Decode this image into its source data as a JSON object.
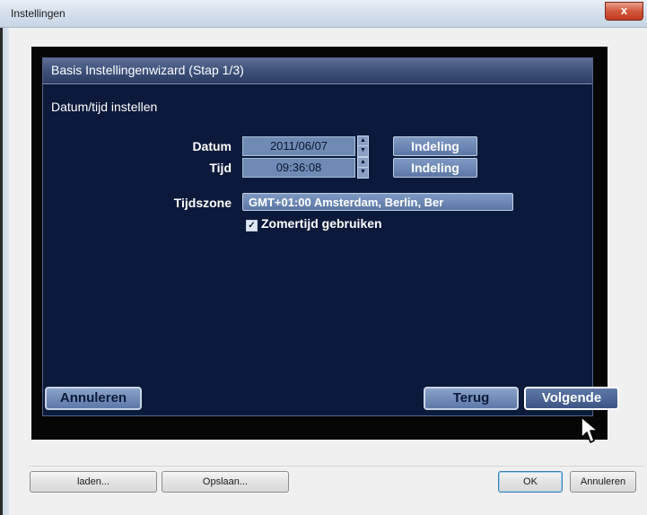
{
  "window": {
    "title": "Instellingen",
    "close_label": "x"
  },
  "wizard": {
    "header": "Basis Instellingenwizard (Stap 1/3)",
    "section_title": "Datum/tijd instellen",
    "date": {
      "label": "Datum",
      "value": "2011/06/07",
      "format_button": "Indeling"
    },
    "time": {
      "label": "Tijd",
      "value": "09:36:08",
      "format_button": "Indeling"
    },
    "timezone": {
      "label": "Tijdszone",
      "value": "GMT+01:00  Amsterdam, Berlin, Ber"
    },
    "dst": {
      "label": "Zomertijd gebruiken",
      "checked": true
    },
    "buttons": {
      "cancel": "Annuleren",
      "back": "Terug",
      "next": "Volgende"
    }
  },
  "footer": {
    "load": "laden...",
    "save": "Opslaan...",
    "ok": "OK",
    "cancel": "Annuleren"
  },
  "icons": [
    "close-icon",
    "spin-up-icon",
    "spin-down-icon",
    "checkbox-checked-icon",
    "mouse-pointer-icon"
  ]
}
